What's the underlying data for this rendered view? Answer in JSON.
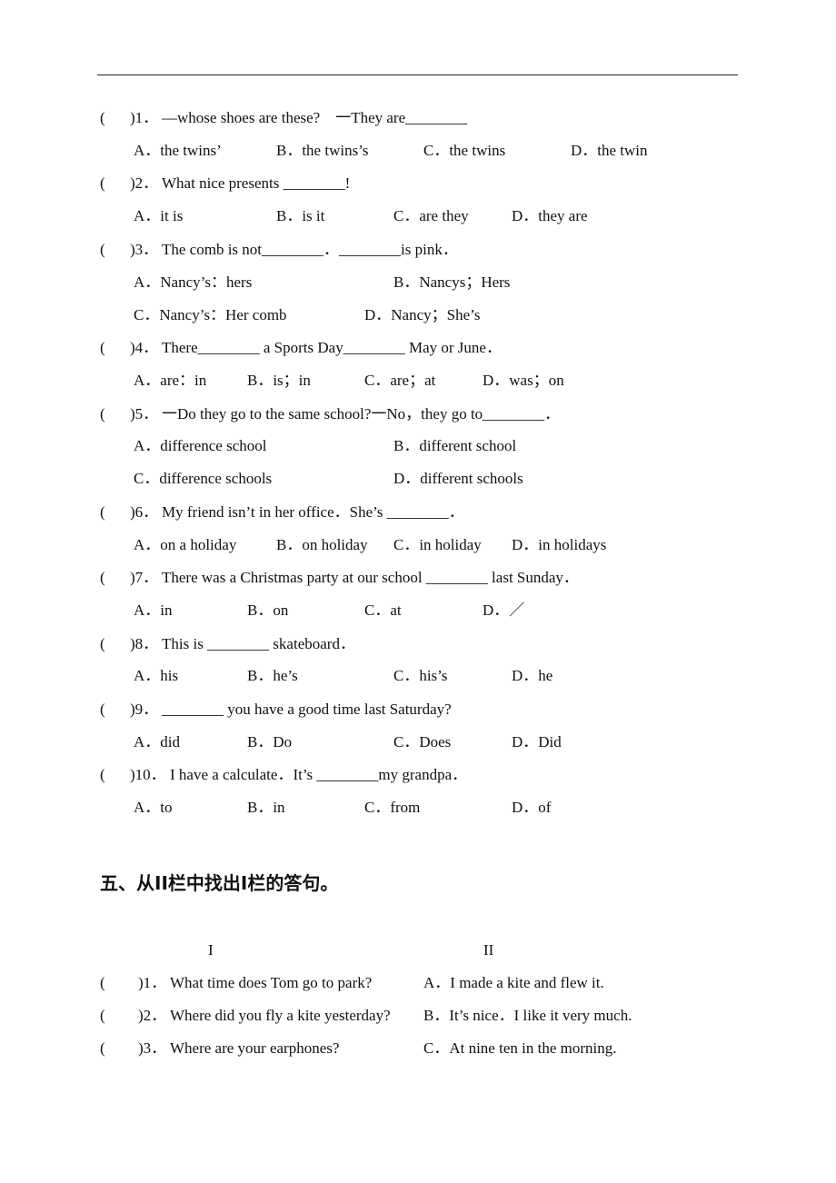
{
  "mcq": [
    {
      "num": ")1．",
      "stem": "—whose shoes are these?　一They are________",
      "rows": [
        [
          "A．the twins’",
          "B．the twins’s",
          "C．the twins",
          "D．the twin"
        ]
      ]
    },
    {
      "num": ")2．",
      "stem": "What nice presents ________!",
      "rows": [
        [
          "A．it is",
          "B．is it",
          "C．are they",
          "D．they are"
        ]
      ]
    },
    {
      "num": ")3．",
      "stem": "The comb is not________．________is pink．",
      "rows": [
        [
          "A．Nancy’s：hers",
          "B．Nancys；Hers"
        ],
        [
          "C．Nancy’s：Her comb",
          "D．Nancy；She’s"
        ]
      ]
    },
    {
      "num": ")4．",
      "stem": "There________ a Sports Day________ May or June．",
      "rows": [
        [
          "A．are：in",
          "B．is；in",
          "C．are；at",
          "D．was；on"
        ]
      ]
    },
    {
      "num": ")5．",
      "stem": "一Do they go to the same school?一No，they go to________．",
      "rows": [
        [
          "A．difference school",
          "B．different school"
        ],
        [
          "C．difference schools",
          "D．different schools"
        ]
      ]
    },
    {
      "num": ")6．",
      "stem": "My friend isn’t in her office．She’s ________．",
      "rows": [
        [
          "A．on a holiday",
          "B．on holiday",
          "C．in holiday",
          "D．in holidays"
        ]
      ]
    },
    {
      "num": ")7．",
      "stem": "There was a Christmas party at our school ________ last Sunday．",
      "rows": [
        [
          "A．in",
          "B．on",
          "C．at",
          "D．／"
        ]
      ]
    },
    {
      "num": ")8．",
      "stem": "This is ________ skateboard．",
      "rows": [
        [
          "A．his",
          "B．he’s",
          "C．his’s",
          "D．he"
        ]
      ]
    },
    {
      "num": ")9．",
      "stem": "________ you have a good time last Saturday?",
      "rows": [
        [
          "A．did",
          "B．Do",
          "C．Does",
          "D．Did"
        ]
      ]
    },
    {
      "num": ")10．",
      "stem": "I have a calculate．It’s ________my grandpa．",
      "rows": [
        [
          "A．to",
          "B．in",
          "C．from",
          "D．of"
        ]
      ]
    }
  ],
  "section5": {
    "heading": "五、从II栏中找出Ⅰ栏的答句。",
    "col1_header": "I",
    "col2_header": "II",
    "rows": [
      {
        "num": ")1．",
        "question": "What time does Tom go to park?",
        "answer": "A．I made a kite and flew it."
      },
      {
        "num": ")2．",
        "question": "Where did you fly a kite yesterday?",
        "answer": "B．It’s nice．I like it very much."
      },
      {
        "num": ")3．",
        "question": "Where are your earphones?",
        "answer": "C．At nine ten in the morning."
      }
    ]
  }
}
